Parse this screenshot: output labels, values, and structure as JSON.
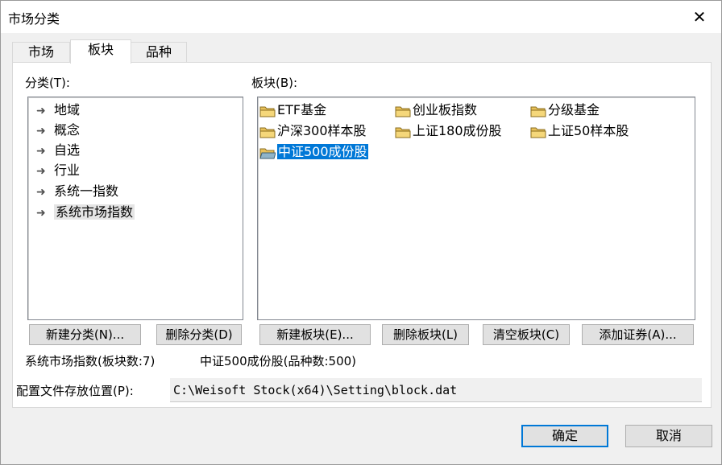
{
  "window": {
    "title": "市场分类",
    "close_glyph": "✕"
  },
  "tabs": [
    {
      "label": "市场"
    },
    {
      "label": "板块"
    },
    {
      "label": "品种"
    }
  ],
  "category": {
    "label": "分类(T):",
    "items": [
      {
        "label": "地域"
      },
      {
        "label": "概念"
      },
      {
        "label": "自选"
      },
      {
        "label": "行业"
      },
      {
        "label": "系统一指数"
      },
      {
        "label": "系统市场指数"
      }
    ],
    "selected_index": 5
  },
  "blocks": {
    "label": "板块(B):",
    "items": [
      {
        "label": "ETF基金"
      },
      {
        "label": "创业板指数"
      },
      {
        "label": "分级基金"
      },
      {
        "label": "沪深300样本股"
      },
      {
        "label": "上证180成份股"
      },
      {
        "label": "上证50样本股"
      },
      {
        "label": "中证500成份股"
      }
    ],
    "selected_index": 6
  },
  "buttons": {
    "new_category": "新建分类(N)...",
    "delete_category": "删除分类(D)",
    "new_block": "新建板块(E)...",
    "delete_block": "删除板块(L)",
    "clear_block": "清空板块(C)",
    "add_security": "添加证券(A)..."
  },
  "status": {
    "category_info": "系统市场指数(板块数:7)",
    "block_info": "中证500成份股(品种数:500)"
  },
  "config": {
    "label": "配置文件存放位置(P):",
    "path": "C:\\Weisoft Stock(x64)\\Setting\\block.dat"
  },
  "footer": {
    "ok": "确定",
    "cancel": "取消"
  },
  "colors": {
    "selection": "#0078d7",
    "folder": "#e8c15a"
  },
  "icons": {
    "category_item": "arrow-right-icon",
    "block_item": "folder-icon"
  }
}
